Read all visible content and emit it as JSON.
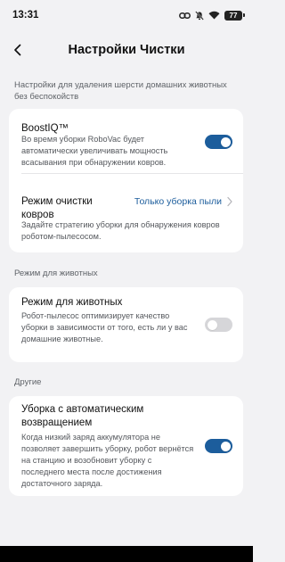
{
  "status_bar": {
    "time": "13:31",
    "battery": "77"
  },
  "nav": {
    "title": "Настройки Чистки"
  },
  "sections": {
    "pet_hair_caption": "Настройки для удаления шерсти домашних животных без беспокойств",
    "boost": {
      "title": "BoostIQ™",
      "description": "Во время уборки RoboVac будет автоматически увеличивать мощность всасывания при обнаружении ковров.",
      "enabled": true
    },
    "carpet": {
      "title": "Режим очистки ковров",
      "value": "Только уборка пыли",
      "description": "Задайте стратегию уборки для обнаружения ковров роботом-пылесосом."
    },
    "pet_caption": "Режим для животных",
    "pet_mode": {
      "title": "Режим для животных",
      "description": "Робот-пылесос оптимизирует качество уборки в зависимости от того, есть ли у вас домашние животные.",
      "enabled": false
    },
    "other_caption": "Другие",
    "auto_return": {
      "title": "Уборка с автоматическим возвращением",
      "description": "Когда низкий заряд аккумулятора не позволяет завершить уборку, робот вернётся на станцию и возобновит уборку с последнего места после достижения достаточного заряда.",
      "enabled": true
    }
  },
  "colors": {
    "accent": "#1c5d9c",
    "background": "#f2f2f4",
    "card": "#ffffff",
    "toggle_off": "#d6d6d9"
  }
}
